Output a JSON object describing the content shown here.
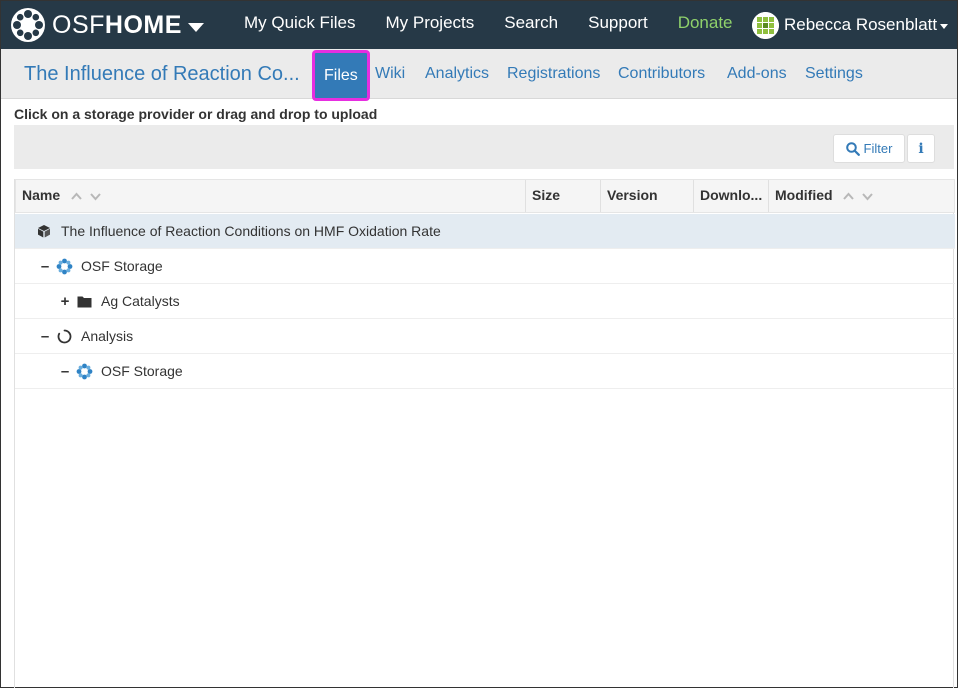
{
  "brand": {
    "light": "OSF",
    "bold": "HOME"
  },
  "topnav": {
    "items": [
      "My Quick Files",
      "My Projects",
      "Search",
      "Support",
      "Donate"
    ],
    "user": "Rebecca Rosenblatt"
  },
  "subnav": {
    "project_title": "The Influence of Reaction Co...",
    "tabs": [
      "Files",
      "Wiki",
      "Analytics",
      "Registrations",
      "Contributors",
      "Add-ons",
      "Settings"
    ],
    "active_tab": "Files"
  },
  "hint": "Click on a storage provider or drag and drop to upload",
  "toolbar": {
    "filter_label": "Filter",
    "info_label": "i"
  },
  "grid": {
    "columns": [
      "Name",
      "Size",
      "Version",
      "Downlo...",
      "Modified"
    ],
    "rows": [
      {
        "label": "The Influence of Reaction Conditions on HMF Oxidation Rate",
        "icon": "project-cube-icon",
        "toggle": "",
        "level": 0,
        "selected": true
      },
      {
        "label": "OSF Storage",
        "icon": "osf-storage-icon",
        "toggle": "–",
        "level": 1
      },
      {
        "label": "Ag Catalysts",
        "icon": "folder-icon",
        "toggle": "+",
        "level": 2
      },
      {
        "label": "Analysis",
        "icon": "loading-spinner-icon",
        "toggle": "–",
        "level": 1
      },
      {
        "label": "OSF Storage",
        "icon": "osf-storage-icon",
        "toggle": "–",
        "level": 2
      }
    ]
  },
  "colors": {
    "navbar": "#263947",
    "link": "#337ab7",
    "donate": "#8fd16b",
    "highlight": "#e62ee0",
    "selected_row": "#e3ebf2"
  }
}
